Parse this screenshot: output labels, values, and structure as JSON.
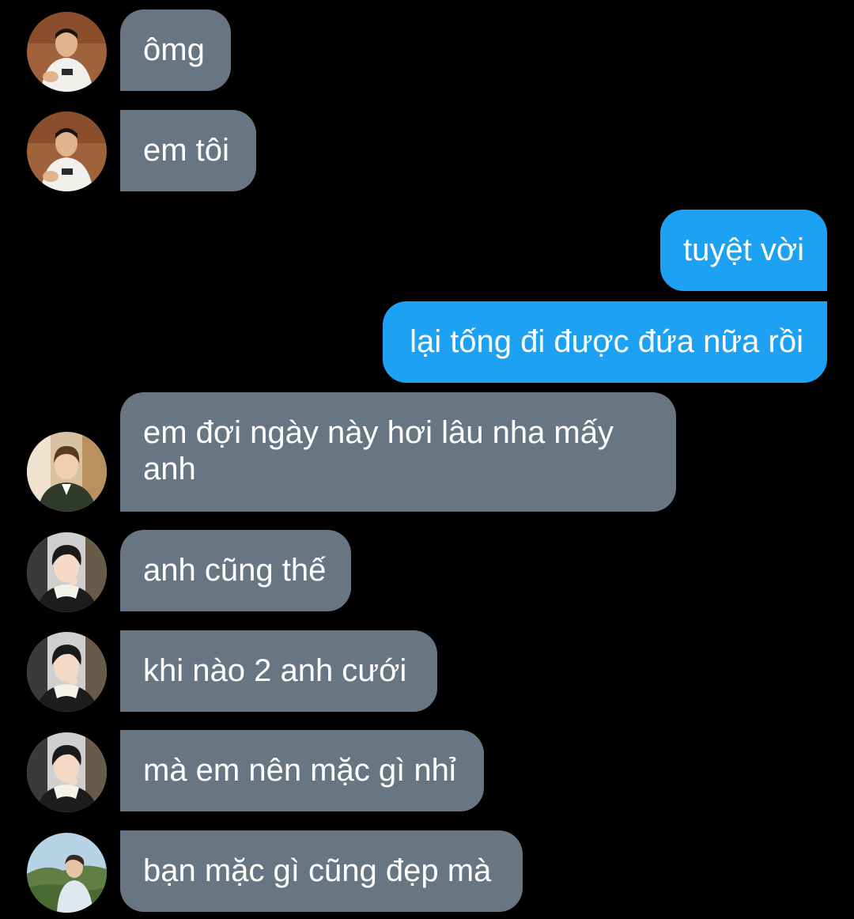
{
  "conversation": {
    "messages": [
      {
        "id": "m1",
        "direction": "incoming",
        "avatar": "avatar-a",
        "text": "ômg"
      },
      {
        "id": "m2",
        "direction": "incoming",
        "avatar": "avatar-a",
        "text": "em tôi"
      },
      {
        "id": "m3",
        "direction": "outgoing",
        "text": "tuyệt vời"
      },
      {
        "id": "m4",
        "direction": "outgoing",
        "text": "lại tống đi được đứa nữa rồi"
      },
      {
        "id": "m5",
        "direction": "incoming",
        "avatar": "avatar-b",
        "text": "em đợi ngày này hơi lâu nha mấy anh"
      },
      {
        "id": "m6",
        "direction": "incoming",
        "avatar": "avatar-c",
        "text": "anh cũng thế"
      },
      {
        "id": "m7",
        "direction": "incoming",
        "avatar": "avatar-c",
        "text": "khi nào 2 anh cưới"
      },
      {
        "id": "m8",
        "direction": "incoming",
        "avatar": "avatar-c",
        "text": "mà em nên mặc gì nhỉ"
      },
      {
        "id": "m9",
        "direction": "incoming",
        "avatar": "avatar-d",
        "text": "bạn mặc gì cũng đẹp mà"
      }
    ]
  },
  "colors": {
    "background": "#000000",
    "incoming_bubble": "#687684",
    "outgoing_bubble": "#1da1f2",
    "text": "#ffffff"
  }
}
